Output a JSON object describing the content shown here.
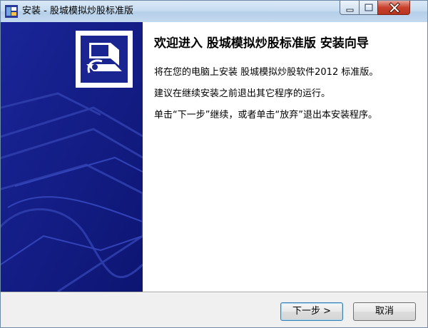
{
  "window": {
    "title": "安装 - 股城模拟炒股标准版",
    "icon": "installer-app-icon",
    "controls": [
      "minimize-icon",
      "maximize-icon",
      "close-icon"
    ]
  },
  "content": {
    "heading": "欢迎进入 股城模拟炒股标准版 安装向导",
    "paragraphs": [
      "将在您的电脑上安装 股城模拟炒股软件2012 标准版。",
      "建议在继续安装之前退出其它程序的运行。",
      "单击“下一步”继续，或者单击“放弃”退出本安装程序。"
    ]
  },
  "buttons": {
    "next": "下一步 >",
    "cancel": "取消"
  },
  "colors": {
    "sidebar": "#121c86",
    "titlebar": "#c5dbf0",
    "close": "#c8412c"
  }
}
